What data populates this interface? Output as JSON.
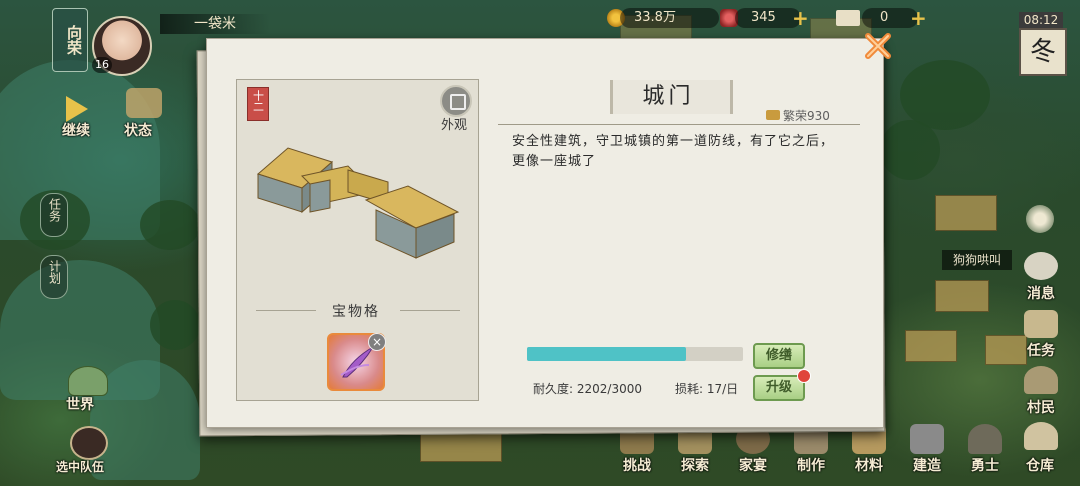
{
  "top_bar": {
    "reputation_label": "向荣",
    "player_level": "16",
    "player_name": "一袋米",
    "coins": "33.8万",
    "gems": "345",
    "tickets": "0",
    "time": "08:12",
    "season": "冬"
  },
  "left_menu": {
    "continue_label": "继续",
    "status_label": "状态",
    "tasks_tab": "任务",
    "plan_tab": "计划",
    "world_label": "世界",
    "team_label": "选中队伍"
  },
  "right_menu": {
    "villager_name": "狗狗哄叫",
    "items": [
      "消息",
      "任务",
      "村民",
      "仓库"
    ]
  },
  "bottom_menu": {
    "items": [
      "挑战",
      "探索",
      "家宴",
      "制作",
      "材料",
      "建造",
      "勇士",
      "仓库"
    ]
  },
  "building": {
    "grade_badge": "十二",
    "appearance_label": "外观",
    "name": "城门",
    "prosperity": "繁荣930",
    "description": "安全性建筑，守卫城镇的第一道防线，有了它之后，更像一座城了",
    "treasure_slot_label": "宝物格",
    "durability_text": "耐久度: 2202/3000",
    "durability_fraction": 0.734,
    "wear_text": "损耗: 17/日",
    "repair_button": "修缮",
    "upgrade_button": "升级"
  },
  "colors": {
    "durability_fill": "#4fc2c6",
    "button_green": "#a9cf85",
    "close_orange": "#f08a3a",
    "badge_red": "#c94e48"
  },
  "icons": [
    "close-icon",
    "appearance-icon",
    "treasure-feather-icon",
    "remove-x-icon",
    "notification-dot-icon"
  ]
}
